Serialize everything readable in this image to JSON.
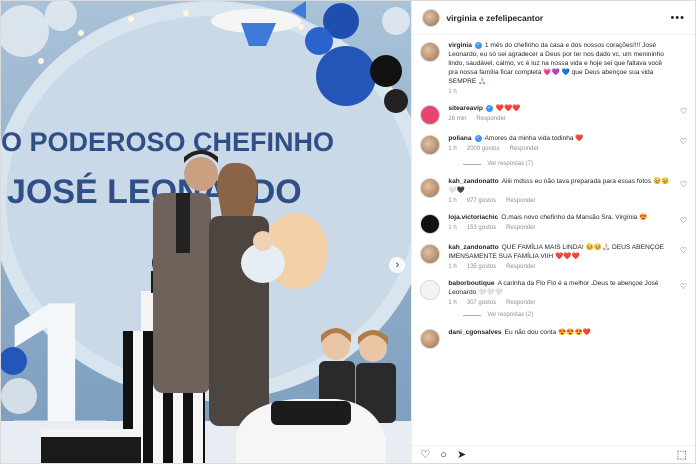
{
  "post": {
    "author_line": "virginia e zefelipecantor",
    "caption_user": "virginia",
    "caption_text": "1 mês do chefinho da casa e dos nossos corações!!!! José Leonardo, eu só sei agradecer a Deus por ter nos dado vc, um menininho lindo, saudável, calmo, vc é luz na nossa vida e hoje sei que faltava você pra nossa família ficar completa 💗💜 💙 que Deus abençoe sua vida SEMPRE 🙏🏻",
    "caption_time": "1 h"
  },
  "banner": {
    "line1": "O PODEROSO CHEFINHO",
    "line2": "JOSÉ LEONARDO",
    "big_number": "1"
  },
  "comments": [
    {
      "user": "siteareavip",
      "verified": true,
      "text": "❤️❤️❤️",
      "time": "26 min",
      "likes": "",
      "reply": "Responder"
    },
    {
      "user": "poliana",
      "verified": true,
      "text": "Amores da minha vida todinha ❤️",
      "time": "1 h",
      "likes": "2009 gostos",
      "reply": "Responder",
      "more": "Ver respostas (7)"
    },
    {
      "user": "kah_zandonatto",
      "verified": false,
      "text": "Aiiii mdsss eu não tava preparada para essas fotos 🥹🥹🤍🖤",
      "time": "1 h",
      "likes": "977 gostos",
      "reply": "Responder"
    },
    {
      "user": "loja.victoriachic",
      "verified": false,
      "text": "O.mais novo chefinho da Mansão Sra. Virgínia 😍",
      "time": "1 h",
      "likes": "153 gostos",
      "reply": "Responder"
    },
    {
      "user": "kah_zandonatto",
      "verified": false,
      "text": "QUE FAMÍLIA MAIS LINDA! 🥹🥹🙏🏻 DEUS ABENÇOE IMENSAMENTE SUA FAMÍLIA VIIH ❤️❤️❤️",
      "time": "1 h",
      "likes": "135 gostos",
      "reply": "Responder"
    },
    {
      "user": "baborboutique",
      "verified": false,
      "text": "A carinha da Flo Flo é a melhor .Deus te abençoe José Leonardo 🤍🤍🤍",
      "time": "1 h",
      "likes": "307 gostos",
      "reply": "Responder",
      "more": "Ver respostas (2)"
    },
    {
      "user": "dani_cgonsalves",
      "verified": false,
      "text": "Eu não dou conta 😍😍😍❤️",
      "time": "",
      "likes": "",
      "reply": ""
    }
  ],
  "icons": {
    "heart": "♡",
    "comment": "○",
    "share": "➤",
    "save": "⬚",
    "more": "•••",
    "next": "›"
  },
  "colors": {
    "verified": "#3897f0",
    "banner_text": "#2f4f86"
  }
}
